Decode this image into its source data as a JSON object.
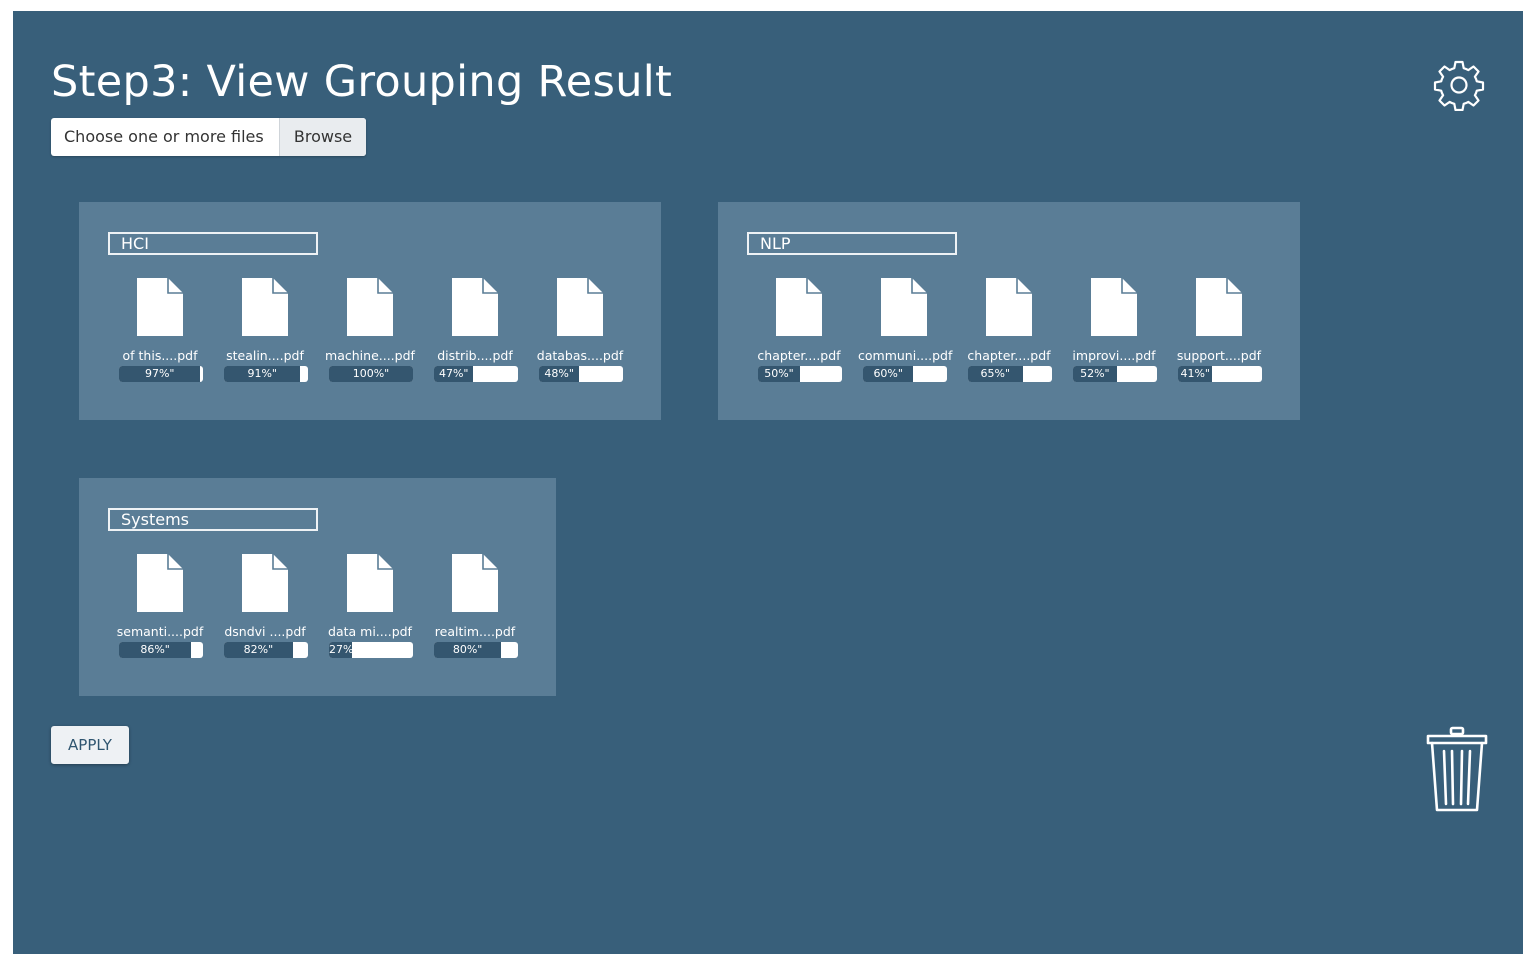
{
  "header": {
    "title": "Step3: View Grouping Result",
    "file_placeholder": "Choose one or more files",
    "browse_label": "Browse",
    "settings_icon": "gear-icon"
  },
  "groups": [
    {
      "name": "HCI",
      "files": [
        {
          "name": "of this....pdf",
          "percent": 97,
          "label": "97%\""
        },
        {
          "name": "stealin....pdf",
          "percent": 91,
          "label": "91%\""
        },
        {
          "name": "machine....pdf",
          "percent": 100,
          "label": "100%\""
        },
        {
          "name": "distrib....pdf",
          "percent": 47,
          "label": "47%\""
        },
        {
          "name": "databas....pdf",
          "percent": 48,
          "label": "48%\""
        }
      ]
    },
    {
      "name": "NLP",
      "files": [
        {
          "name": "chapter....pdf",
          "percent": 50,
          "label": "50%\""
        },
        {
          "name": "communi....pdf",
          "percent": 60,
          "label": "60%\""
        },
        {
          "name": "chapter....pdf",
          "percent": 65,
          "label": "65%\""
        },
        {
          "name": "improvi....pdf",
          "percent": 52,
          "label": "52%\""
        },
        {
          "name": "support....pdf",
          "percent": 41,
          "label": "41%\""
        }
      ]
    },
    {
      "name": "Systems",
      "files": [
        {
          "name": "semanti....pdf",
          "percent": 86,
          "label": "86%\""
        },
        {
          "name": "dsndvi ....pdf",
          "percent": 82,
          "label": "82%\""
        },
        {
          "name": "data mi....pdf",
          "percent": 27,
          "label": "27%\""
        },
        {
          "name": "realtim....pdf",
          "percent": 80,
          "label": "80%\""
        }
      ]
    }
  ],
  "actions": {
    "apply_label": "APPLY",
    "trash_icon": "trash-icon"
  },
  "colors": {
    "background": "#385f7a",
    "group_panel": "#5a7d96",
    "bar_fill": "#34566f"
  }
}
